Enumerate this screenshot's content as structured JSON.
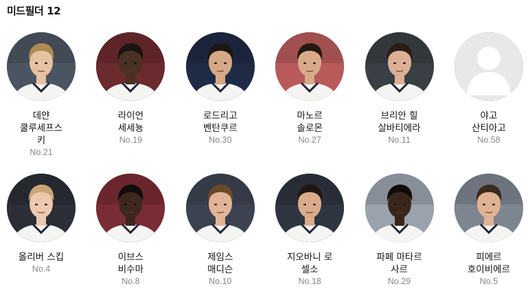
{
  "section": {
    "title": "미드필더",
    "count": "12"
  },
  "players_row1": [
    {
      "name": "데얀\n쿨루세프스\n키",
      "number": "No.21",
      "photo": {
        "bg": "#4a5561",
        "skin": "#e7c2a2",
        "hair": "#b08a52"
      }
    },
    {
      "name": "라이언\n세세뇽",
      "number": "No.19",
      "photo": {
        "bg": "#6b2a2e",
        "skin": "#4b3024",
        "hair": "#1b1410"
      }
    },
    {
      "name": "로드리고\n벤탄쿠르",
      "number": "No.30",
      "photo": {
        "bg": "#1f2a44",
        "skin": "#d6a886",
        "hair": "#1d1712"
      }
    },
    {
      "name": "마노르\n솔로몬",
      "number": "No.27",
      "photo": {
        "bg": "#b85a5a",
        "skin": "#d8aa88",
        "hair": "#231a14"
      }
    },
    {
      "name": "브리안 힐\n살바티에라",
      "number": "No.11",
      "photo": {
        "bg": "#3a3f45",
        "skin": "#dcb094",
        "hair": "#2a1d15"
      }
    },
    {
      "name": "야고\n산티아고",
      "number": "No.58",
      "photo": {
        "bg": "#e8e8e8",
        "placeholder": true
      }
    }
  ],
  "players_row2": [
    {
      "name": "올리버 스킵",
      "number": "No.4",
      "photo": {
        "bg": "#2b2e36",
        "skin": "#ecc8ae",
        "hair": "#c9a57a"
      }
    },
    {
      "name": "이브스\n비수마",
      "number": "No.8",
      "photo": {
        "bg": "#7a2c34",
        "skin": "#3e271d",
        "hair": "#120d0a"
      }
    },
    {
      "name": "제임스\n매디슨",
      "number": "No.10",
      "photo": {
        "bg": "#3c4250",
        "skin": "#e2b497",
        "hair": "#6b4a2c"
      }
    },
    {
      "name": "지오바니 로\n셀소",
      "number": "No.18",
      "photo": {
        "bg": "#2e3440",
        "skin": "#d9ab8b",
        "hair": "#1f1812"
      }
    },
    {
      "name": "파페 마타르\n사르",
      "number": "No.29",
      "photo": {
        "bg": "#9aa2ad",
        "skin": "#3a251b",
        "hair": "#100c09"
      }
    },
    {
      "name": "피에르\n호이비에르",
      "number": "No.5",
      "photo": {
        "bg": "#7e8590",
        "skin": "#dfb294",
        "hair": "#3a2a1c"
      }
    }
  ]
}
